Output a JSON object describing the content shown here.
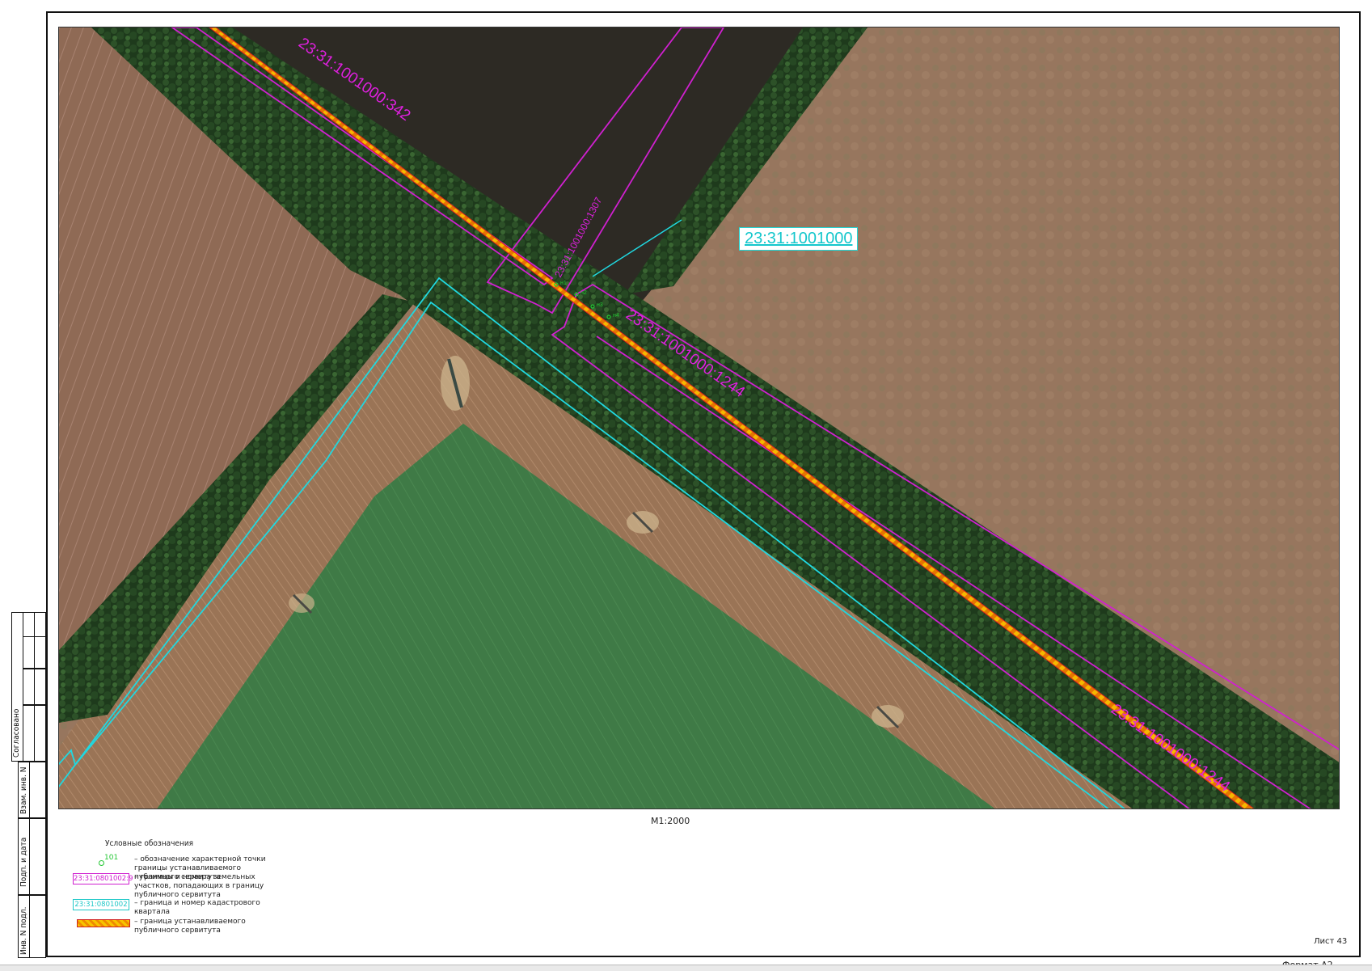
{
  "map": {
    "callout_label": "23:31:1001000",
    "parcel_labels": {
      "p342": "23:31:1001000:342",
      "p1307": "23:31:1001000:1307",
      "p1244_a": "23:31:1001000:1244",
      "p1244_b": "23:31:1001000:1244"
    },
    "point_labels": [
      "н1",
      "н2",
      "н3",
      "н4"
    ],
    "colors": {
      "parcel": "#d020d0",
      "block": "#20d0d0",
      "easement_border": "#e02020",
      "easement_fill": "#f5b800",
      "point": "#23c733"
    }
  },
  "scale": "М1:2000",
  "legend": {
    "title": "Условные обозначения",
    "point_sample": "101",
    "point_text": "– обозначение характерной точки границы устанавливаемого публичного сервитута",
    "parcel_sample": "23:31:0801002:9",
    "parcel_text": "– границы и номера земельных участков, попадающих в границу публичного сервитута",
    "block_sample": "23:31:0801002",
    "block_text": "– граница и номер кадастрового квартала",
    "easement_text": "– граница устанавливаемого публичного сервитута"
  },
  "stamp": {
    "agreed": "Согласовано",
    "inv_replace": "Взам. инв. N",
    "sign_date": "Подп. и дата",
    "inv_orig": "Инв. N подл."
  },
  "sheet_number": "Лист 43",
  "format": "Формат А2"
}
